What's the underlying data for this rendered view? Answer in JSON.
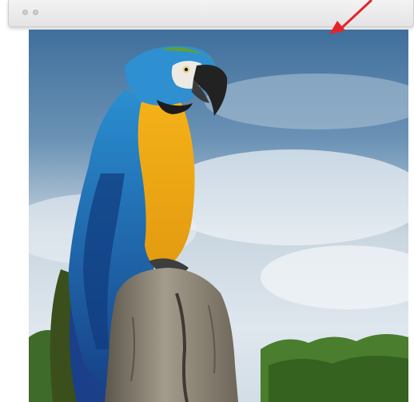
{
  "window": {
    "title": "",
    "controls": [
      "close",
      "minimize",
      "zoom"
    ]
  },
  "annotation": {
    "icon": "red-arrow-icon",
    "color": "#e3242b"
  },
  "content": {
    "image": {
      "subject": "blue-and-yellow-macaw",
      "icon": "photo-icon"
    }
  },
  "colors": {
    "titlebar": "#e8e8e8",
    "sky": "#5b82a8",
    "macaw_blue": "#1f74b8",
    "macaw_yellow": "#f0b317"
  }
}
